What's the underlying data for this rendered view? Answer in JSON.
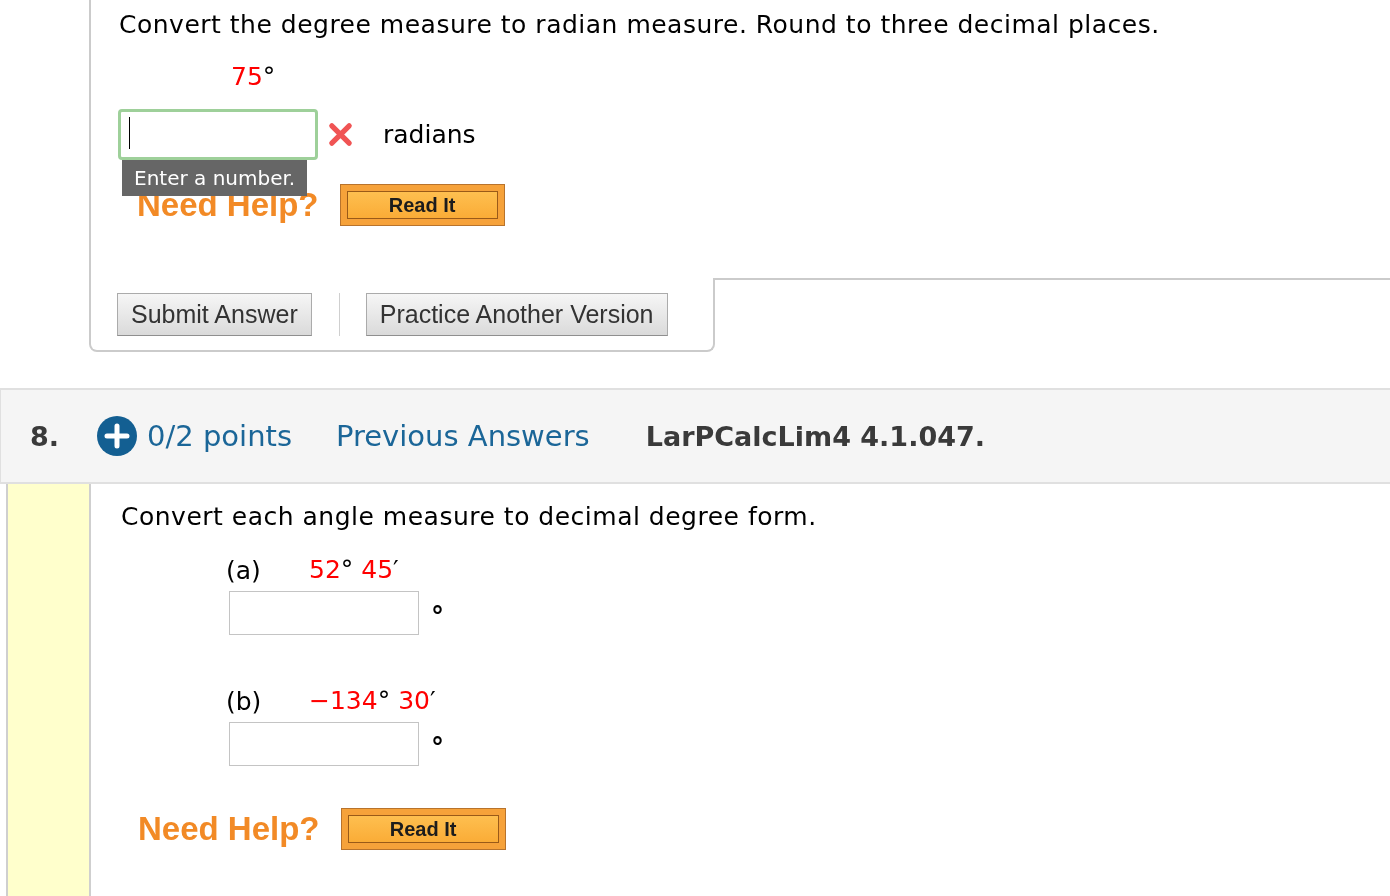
{
  "question_7": {
    "prompt": "Convert the degree measure to radian measure. Round to three decimal places.",
    "given": [
      {
        "kind": "number",
        "text": "75"
      },
      {
        "kind": "unit",
        "text": "°"
      }
    ],
    "answer": {
      "focused": true,
      "incorrect": true,
      "unit": "radians",
      "tooltip": "Enter a number."
    },
    "help": {
      "label": "Need Help?",
      "buttons": [
        "Read It"
      ]
    },
    "actions": [
      "Submit Answer",
      "Practice Another Version"
    ]
  },
  "question_8": {
    "number": "8.",
    "points": "0/2 points",
    "previous_answers": "Previous Answers",
    "reference": "LarPCalcLim4 4.1.047.",
    "prompt": "Convert each angle measure to decimal degree form.",
    "parts": [
      {
        "label": "(a)",
        "given": [
          {
            "kind": "number",
            "text": "52"
          },
          {
            "kind": "unit",
            "text": "°"
          },
          {
            "kind": "number",
            "text": "45"
          },
          {
            "kind": "unit",
            "text": "′"
          }
        ],
        "answer": {
          "focused": false,
          "unit": "°"
        }
      },
      {
        "label": "(b)",
        "given": [
          {
            "kind": "number",
            "text": "−134"
          },
          {
            "kind": "unit",
            "text": "°"
          },
          {
            "kind": "number",
            "text": "30"
          },
          {
            "kind": "unit",
            "text": "′"
          }
        ],
        "answer": {
          "focused": false,
          "unit": "°"
        }
      }
    ],
    "help": {
      "label": "Need Help?",
      "buttons": [
        "Read It"
      ]
    }
  }
}
